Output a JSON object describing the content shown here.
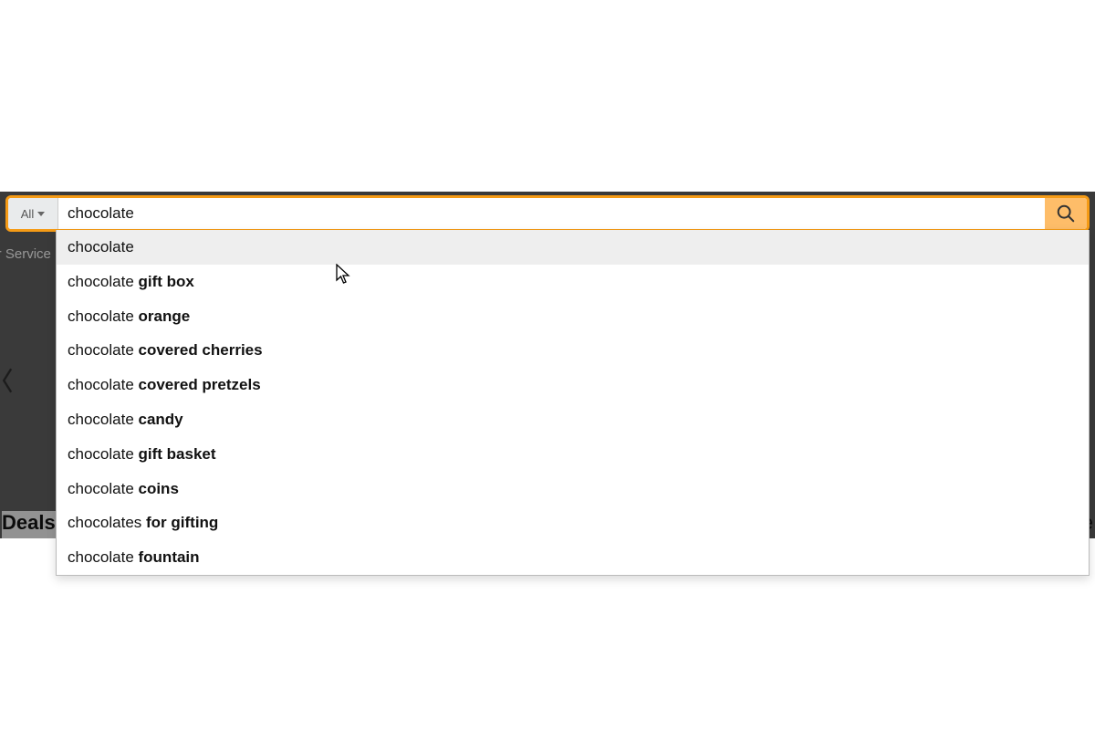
{
  "search": {
    "category_label": "All",
    "query": "chocolate",
    "suggestions": [
      {
        "prefix": "chocolate",
        "bold": ""
      },
      {
        "prefix": "chocolate ",
        "bold": "gift box"
      },
      {
        "prefix": "chocolate ",
        "bold": "orange"
      },
      {
        "prefix": "chocolate ",
        "bold": "covered cherries"
      },
      {
        "prefix": "chocolate ",
        "bold": "covered pretzels"
      },
      {
        "prefix": "chocolate ",
        "bold": "candy"
      },
      {
        "prefix": "chocolate ",
        "bold": "gift basket"
      },
      {
        "prefix": "chocolate ",
        "bold": "coins"
      },
      {
        "prefix": "chocolates ",
        "bold": "for gifting"
      },
      {
        "prefix": "chocolate ",
        "bold": "fountain"
      }
    ],
    "highlighted_index": 0
  },
  "background": {
    "nav_link_partial": "ner Service",
    "deals_partial": "Deals &",
    "right_edge_letter": "e"
  }
}
